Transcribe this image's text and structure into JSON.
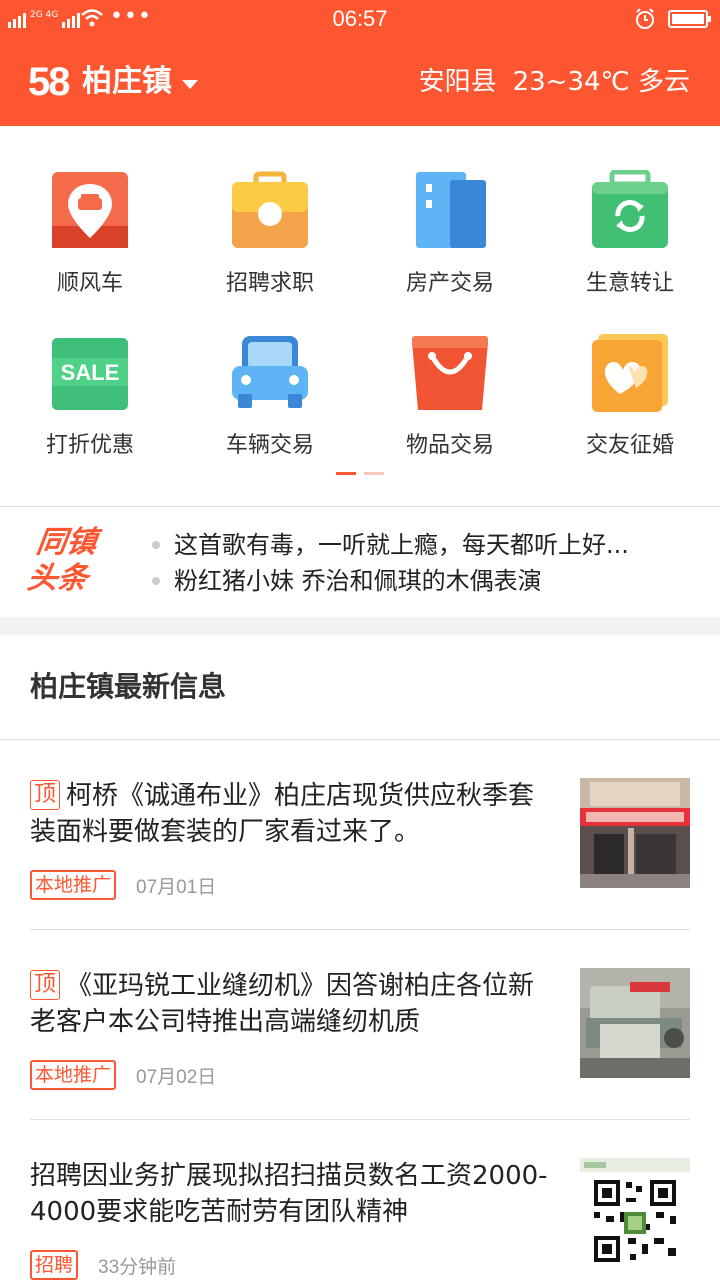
{
  "status": {
    "network": "2G 4G",
    "dots": "•••",
    "time": "06:57"
  },
  "topbar": {
    "logo": "58",
    "town": "柏庄镇",
    "county": "安阳县",
    "weather": "23~34℃ 多云"
  },
  "categories": [
    {
      "label": "顺风车",
      "icon": "car-pin-icon"
    },
    {
      "label": "招聘求职",
      "icon": "briefcase-icon"
    },
    {
      "label": "房产交易",
      "icon": "building-icon"
    },
    {
      "label": "生意转让",
      "icon": "refresh-bag-icon"
    },
    {
      "label": "打折优惠",
      "icon": "sale-tag-icon"
    },
    {
      "label": "车辆交易",
      "icon": "car-icon"
    },
    {
      "label": "物品交易",
      "icon": "shopping-bag-icon"
    },
    {
      "label": "交友征婚",
      "icon": "heart-card-icon"
    }
  ],
  "headline": {
    "logo_line1": "同镇",
    "logo_line2": "头条",
    "items": [
      "这首歌有毒，一听就上瘾，每天都听上好...",
      "粉红猪小妹 乔治和佩琪的木偶表演"
    ]
  },
  "section": {
    "title": "柏庄镇最新信息"
  },
  "listings": [
    {
      "top": "顶",
      "title": "柯桥《诚通布业》柏庄店现货供应秋季套装面料要做套装的厂家看过来了。",
      "tag": "本地推广",
      "date": "07月01日"
    },
    {
      "top": "顶",
      "title": "《亚玛锐工业缝纫机》因答谢柏庄各位新老客户本公司特推出高端缝纫机质",
      "tag": "本地推广",
      "date": "07月02日"
    },
    {
      "top": "",
      "title": "招聘因业务扩展现拟招扫描员数名工资2000-4000要求能吃苦耐劳有团队精神",
      "tag": "招聘",
      "date": "33分钟前"
    }
  ],
  "colors": {
    "accent": "#fd5630"
  }
}
